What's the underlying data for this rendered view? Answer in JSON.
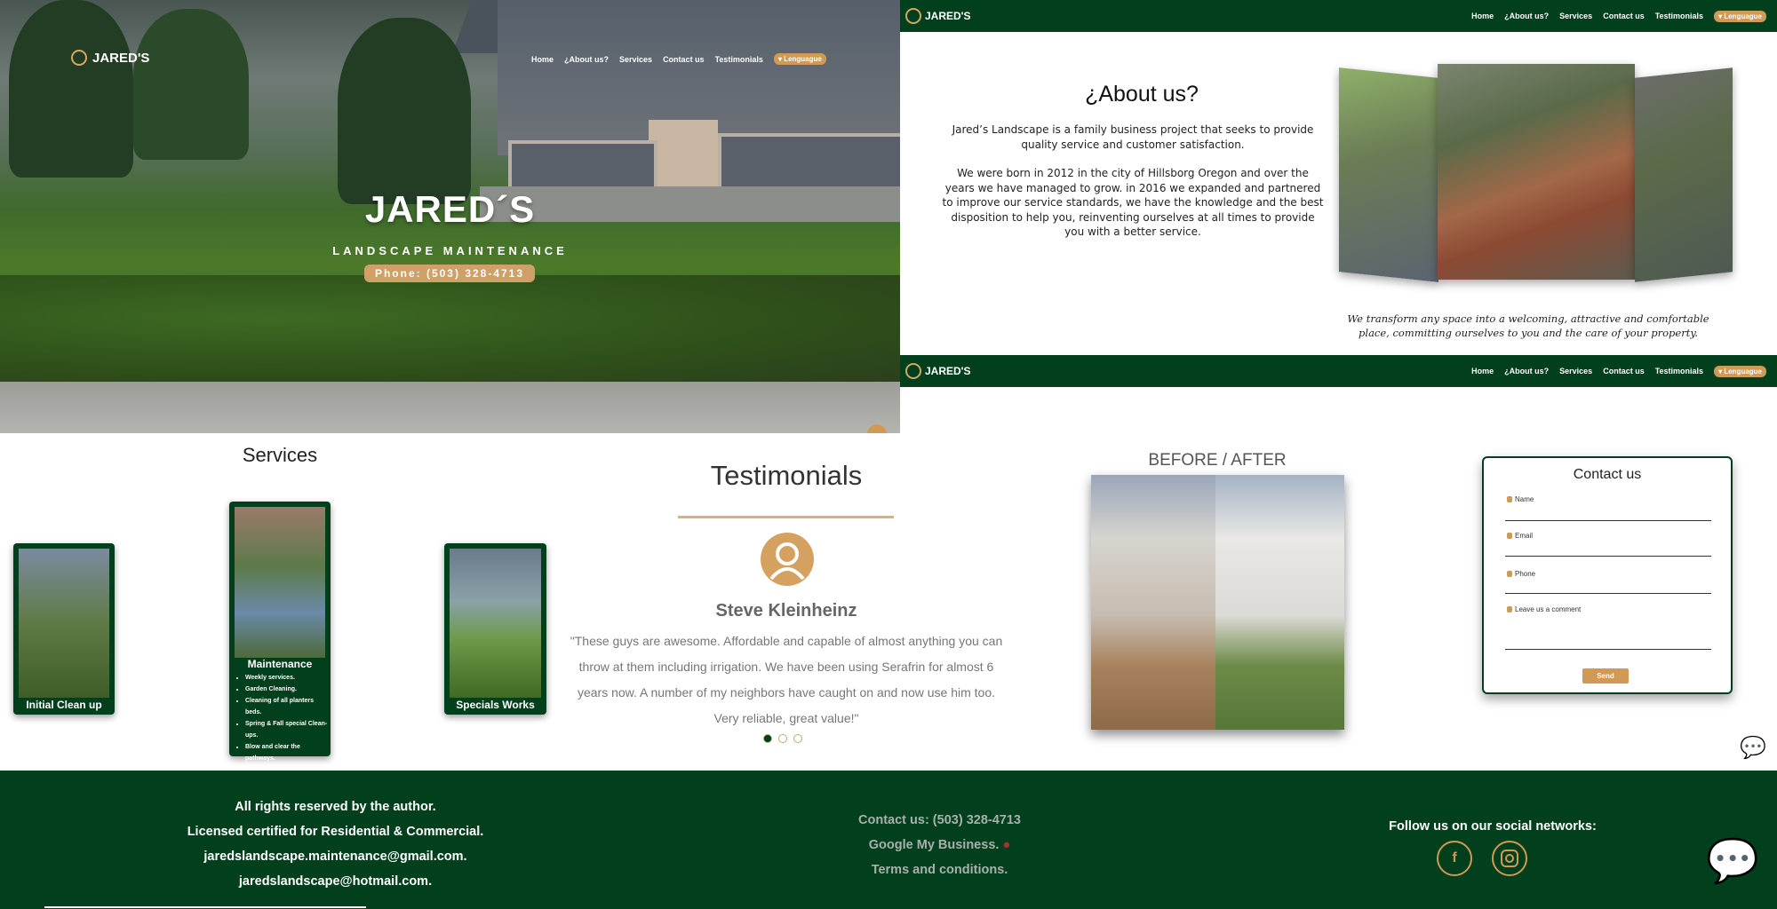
{
  "brand": {
    "name": "JARED'S",
    "tagline": "LANDSCAPE MAINTENANCE"
  },
  "nav": {
    "items": [
      "Home",
      "¿About us?",
      "Services",
      "Contact us",
      "Testimonials"
    ],
    "language": "Lenguague"
  },
  "hero": {
    "title": "JARED´S",
    "subtitle": "LANDSCAPE MAINTENANCE",
    "phone": "Phone: (503) 328-4713"
  },
  "about": {
    "title": "¿About us?",
    "paragraph1": "Jared’s Landscape is a family business project that seeks to provide quality service and customer satisfaction.",
    "paragraph2": "We were born in 2012 in the city of Hillsborg Oregon and over the years we have managed to grow. in 2016 we expanded and partnered to improve our service standards, we have the knowledge and the best disposition to help you, reinventing ourselves at all times to provide you with a better service.",
    "motto": "We transform any space into a welcoming, attractive and comfortable place, committing ourselves to you and the care of your property."
  },
  "services": {
    "title": "Services",
    "cards": [
      {
        "label": "Initial Clean up"
      },
      {
        "label": "Maintenance",
        "items": [
          "Weekly services.",
          "Garden Cleaning.",
          "Cleaning of all planters beds.",
          "Spring & Fall special Clean-ups.",
          "Blow and clear the pathways."
        ]
      },
      {
        "label": "Specials Works"
      }
    ]
  },
  "testimonials": {
    "title": "Testimonials",
    "name": "Steve Kleinheinz",
    "quote": "\"These guys are awesome. Affordable and capable of almost anything you can throw at them including irrigation. We have been using Serafrin for almost 6 years now. A number of my neighbors have caught on and now use him too. Very reliable, great value!\"",
    "active_slide": 1,
    "slides": 3
  },
  "gallery": {
    "title": "BEFORE / AFTER"
  },
  "contact": {
    "title": "Contact us",
    "fields": [
      "Name",
      "Email",
      "Phone",
      "Leave us a comment"
    ],
    "send": "Send"
  },
  "footer": {
    "left": [
      "All rights reserved by the author.",
      "Licensed certified for Residential & Commercial.",
      "jaredslandscape.maintenance@gmail.com.",
      "jaredslandscape@hotmail.com."
    ],
    "middle": [
      "Contact us: (503) 328-4713",
      "Google My Business.",
      "Terms and conditions."
    ],
    "social_title": "Follow us on our social networks:",
    "social_icons": [
      "facebook-icon",
      "instagram-icon"
    ]
  },
  "colors": {
    "primary": "#023f1c",
    "accent": "#d09a56"
  }
}
